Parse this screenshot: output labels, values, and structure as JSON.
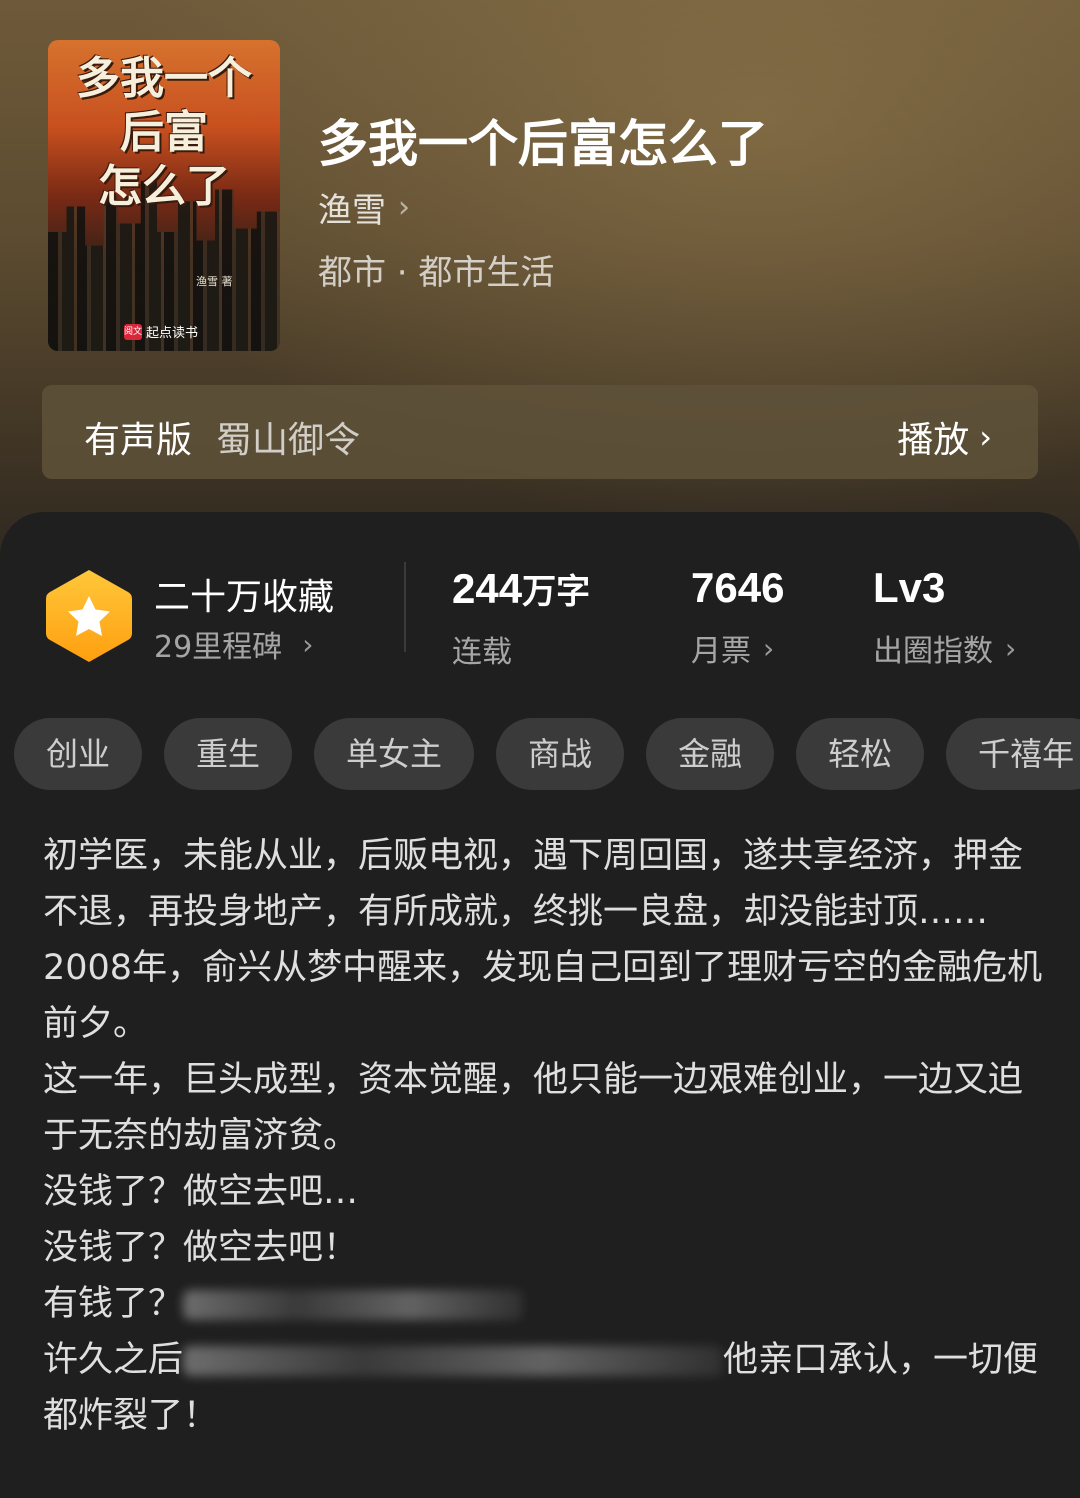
{
  "book": {
    "cover_title_line1": "多我一个",
    "cover_title_line2": "后富",
    "cover_title_line3": "怎么了",
    "cover_author": "渔雪 著",
    "cover_brand": "起点读书",
    "cover_brand_logo": "阅文",
    "title": "多我一个后富怎么了",
    "author": "渔雪",
    "genre": "都市 · 都市生活"
  },
  "audio": {
    "label": "有声版",
    "narrator": "蜀山御令",
    "play_label": "播放"
  },
  "stats": {
    "badge_icon": "star-icon",
    "badge_color": "#ffb21f",
    "favorites": "二十万收藏",
    "milestones": "29里程碑",
    "word_count": "244",
    "word_unit": "万字",
    "status": "连载",
    "monthly_tickets": "7646",
    "monthly_tickets_label": "月票",
    "level": "Lv3",
    "level_label": "出圈指数"
  },
  "tags": [
    "创业",
    "重生",
    "单女主",
    "商战",
    "金融",
    "轻松",
    "千禧年"
  ],
  "synopsis": {
    "p1": "初学医，未能从业，后贩电视，遇下周回国，遂共享经济，押金不退，再投身地产，有所成就，终挑一良盘，却没能封顶……",
    "p2": "2008年，俞兴从梦中醒来，发现自己回到了理财亏空的金融危机前夕。",
    "p3": "这一年，巨头成型，资本觉醒，他只能一边艰难创业，一边又迫于无奈的劫富济贫。",
    "p4": "没钱了？做空去吧…",
    "p5": "没钱了？做空去吧！",
    "p6": "有钱了？",
    "p7_start": "许久之后",
    "p7_end": "他亲口承认，一切便都炸裂了！"
  }
}
